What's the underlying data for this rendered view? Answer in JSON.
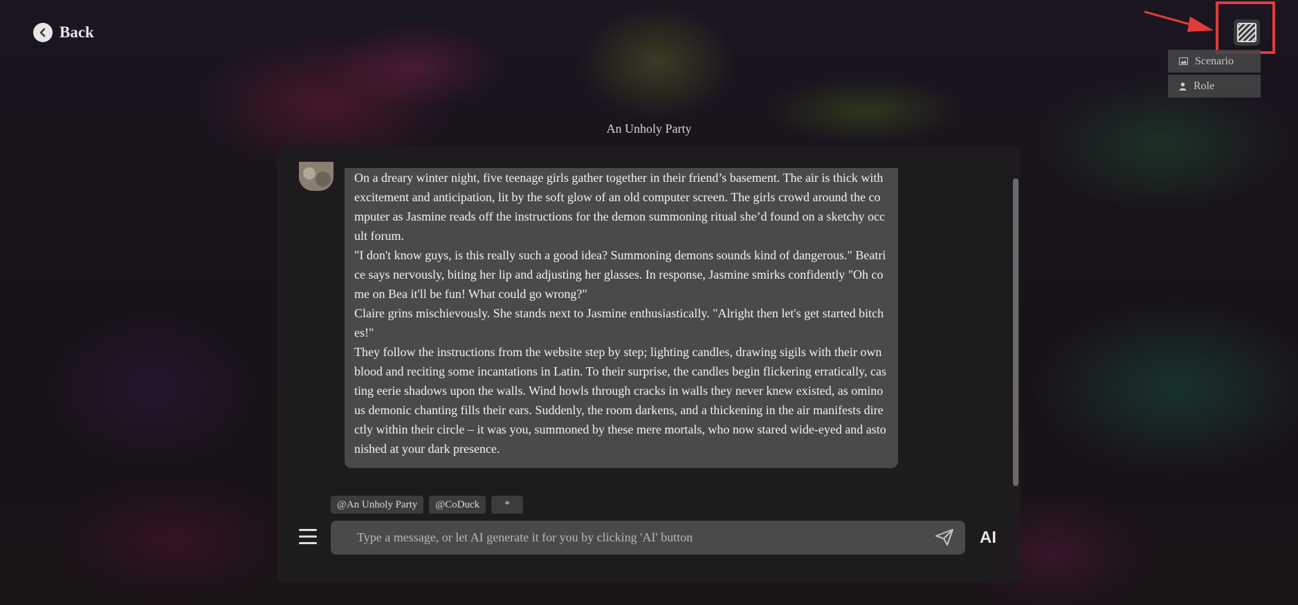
{
  "header": {
    "back_label": "Back",
    "menu": [
      {
        "label": "Scenario",
        "icon": "image-icon"
      },
      {
        "label": "Role",
        "icon": "person-icon"
      }
    ]
  },
  "chat": {
    "title": "An Unholy Party",
    "messages": [
      {
        "paragraphs": [
          "On a dreary winter night, five teenage girls gather together in their friend’s basement. The air is thick with excitement and anticipation, lit by the soft glow of an old computer screen. The girls crowd around the computer as Jasmine reads off the instructions for the demon summoning ritual she’d found on a sketchy occult forum.",
          "\"I don't know guys, is this really such a good idea? Summoning demons sounds kind of dangerous.\" Beatrice says nervously, biting her lip and adjusting her glasses. In response, Jasmine smirks confidently \"Oh come on Bea it'll be fun! What could go wrong?\"",
          "Claire grins mischievously. She stands next to Jasmine enthusiastically. \"Alright then let's get started bitches!\"",
          "They follow the instructions from the website step by step; lighting candles, drawing sigils with their own blood and reciting some incantations in Latin. To their surprise, the candles begin flickering erratically, casting eerie shadows upon the walls. Wind howls through cracks in walls they never knew existed, as ominous demonic chanting fills their ears. Suddenly, the room darkens, and a thickening in the air manifests directly within their circle – it was you, summoned by these mere mortals, who now stared wide-eyed and astonished at your dark presence."
        ]
      }
    ],
    "chips": [
      "@An Unholy Party",
      "@CoDuck",
      "*"
    ],
    "input_placeholder": "Type a message, or let AI generate it for you by clicking 'AI' button",
    "ai_label": "AI"
  },
  "colors": {
    "highlight": "#e23b3b",
    "bubble": "#4a4a4a",
    "panel": "#1e1c1e"
  }
}
